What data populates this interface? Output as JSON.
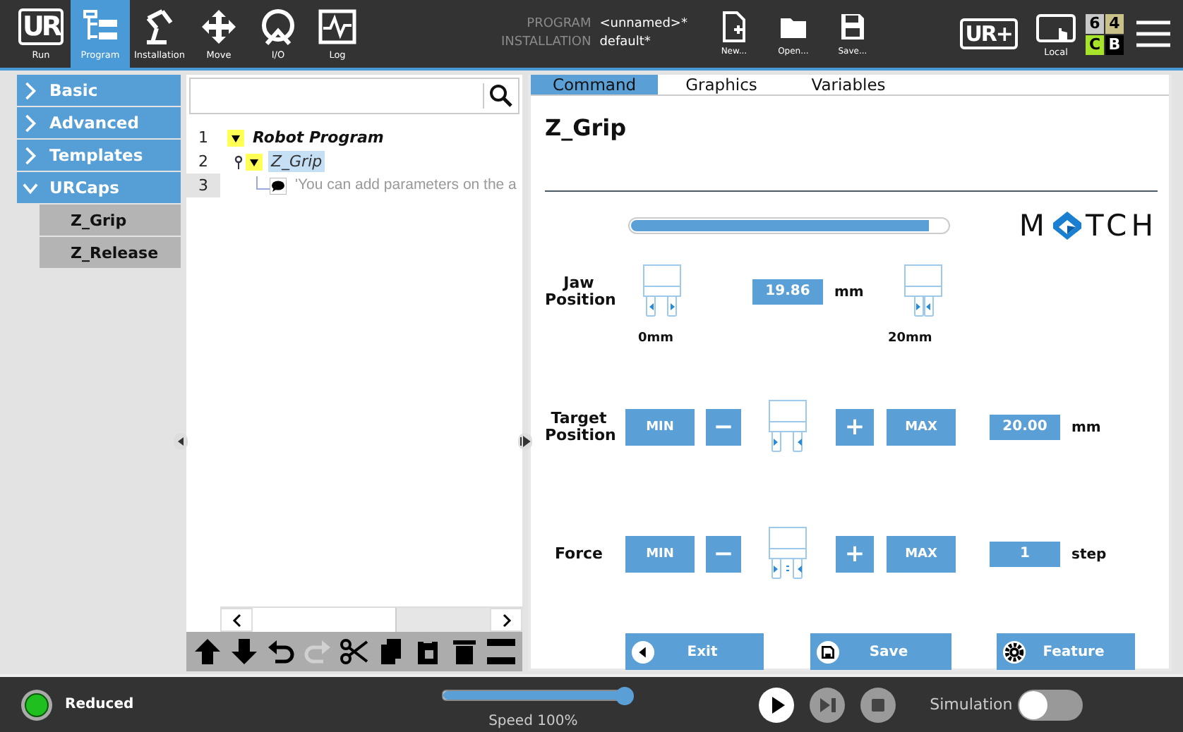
{
  "top_nav": [
    {
      "label": "Run",
      "kind": "logo",
      "glyph": "UR",
      "selected": false
    },
    {
      "label": "Program",
      "kind": "program",
      "selected": true
    },
    {
      "label": "Installation",
      "kind": "installation",
      "selected": false
    },
    {
      "label": "Move",
      "kind": "move",
      "selected": false
    },
    {
      "label": "I/O",
      "kind": "io",
      "selected": false
    },
    {
      "label": "Log",
      "kind": "log",
      "selected": false
    }
  ],
  "program_info": {
    "program_label": "PROGRAM",
    "program_value": "<unnamed>*",
    "installation_label": "INSTALLATION",
    "installation_value": "default*"
  },
  "file_actions": [
    {
      "label": "New...",
      "kind": "new"
    },
    {
      "label": "Open...",
      "kind": "open"
    },
    {
      "label": "Save...",
      "kind": "save"
    }
  ],
  "urplus": {
    "glyph": "UR+"
  },
  "local": {
    "label": "Local"
  },
  "safety_checksum": [
    {
      "text": "6",
      "color": "#c8c8c8"
    },
    {
      "text": "4",
      "color": "#c9c08a"
    },
    {
      "text": "C",
      "color": "#a6e32a"
    },
    {
      "text": "B",
      "color": "#000000"
    }
  ],
  "sidebar": {
    "items": [
      {
        "label": "Basic",
        "expanded": false
      },
      {
        "label": "Advanced",
        "expanded": false
      },
      {
        "label": "Templates",
        "expanded": false
      },
      {
        "label": "URCaps",
        "expanded": true,
        "children": [
          {
            "label": "Z_Grip"
          },
          {
            "label": "Z_Release"
          }
        ]
      }
    ]
  },
  "program_tree": {
    "nodes": [
      {
        "line": "1",
        "label": "Robot Program",
        "kind": "program",
        "selected": false,
        "pinned": false,
        "line_highlight": false,
        "children": [
          {
            "line": "2",
            "label": "Z_Grip",
            "kind": "urcap",
            "selected": true,
            "pinned": true,
            "line_highlight": false,
            "children": [
              {
                "line": "3",
                "label": "'You can add parameters on the a",
                "kind": "comment",
                "selected": false,
                "pinned": false,
                "line_highlight": true
              }
            ]
          }
        ]
      }
    ]
  },
  "tree_toolbar": [
    {
      "kind": "up",
      "disabled": false
    },
    {
      "kind": "down",
      "disabled": false
    },
    {
      "kind": "undo",
      "disabled": false
    },
    {
      "kind": "redo",
      "disabled": true
    },
    {
      "kind": "cut",
      "disabled": false
    },
    {
      "kind": "copy",
      "disabled": false
    },
    {
      "kind": "paste",
      "disabled": false
    },
    {
      "kind": "delete",
      "disabled": false
    },
    {
      "kind": "suppress",
      "disabled": false
    }
  ],
  "tabs": [
    {
      "label": "Command",
      "selected": true
    },
    {
      "label": "Graphics",
      "selected": false
    },
    {
      "label": "Variables",
      "selected": false
    }
  ],
  "node_title": "Z_Grip",
  "gripper": {
    "logo": {
      "left": "M",
      "right": "TCH"
    },
    "jaw_position": {
      "label": "Jaw Position",
      "level": 0.94,
      "value": "19.86",
      "unit": "mm",
      "min_label": "0mm",
      "max_label": "20mm"
    },
    "controls": [
      {
        "label": "Target Position",
        "min": "MIN",
        "minus": "−",
        "plus": "+",
        "max": "MAX",
        "value": "20.00",
        "unit": "mm",
        "kind": "position"
      },
      {
        "label": "Force",
        "min": "MIN",
        "minus": "−",
        "plus": "+",
        "max": "MAX",
        "value": "1",
        "unit": "step",
        "kind": "force"
      }
    ],
    "actions": [
      {
        "label": "Exit",
        "kind": "exit"
      },
      {
        "label": "Save",
        "kind": "save"
      },
      {
        "label": "Feature",
        "kind": "feature"
      }
    ]
  },
  "status_bar": {
    "safety_label": "Reduced",
    "speed": {
      "level": 1,
      "label": "Speed 100%"
    },
    "playback": [
      {
        "kind": "play",
        "disabled": false
      },
      {
        "kind": "step",
        "disabled": true
      },
      {
        "kind": "stop",
        "disabled": true
      }
    ],
    "simulation": {
      "label": "Simulation",
      "on": false
    }
  }
}
